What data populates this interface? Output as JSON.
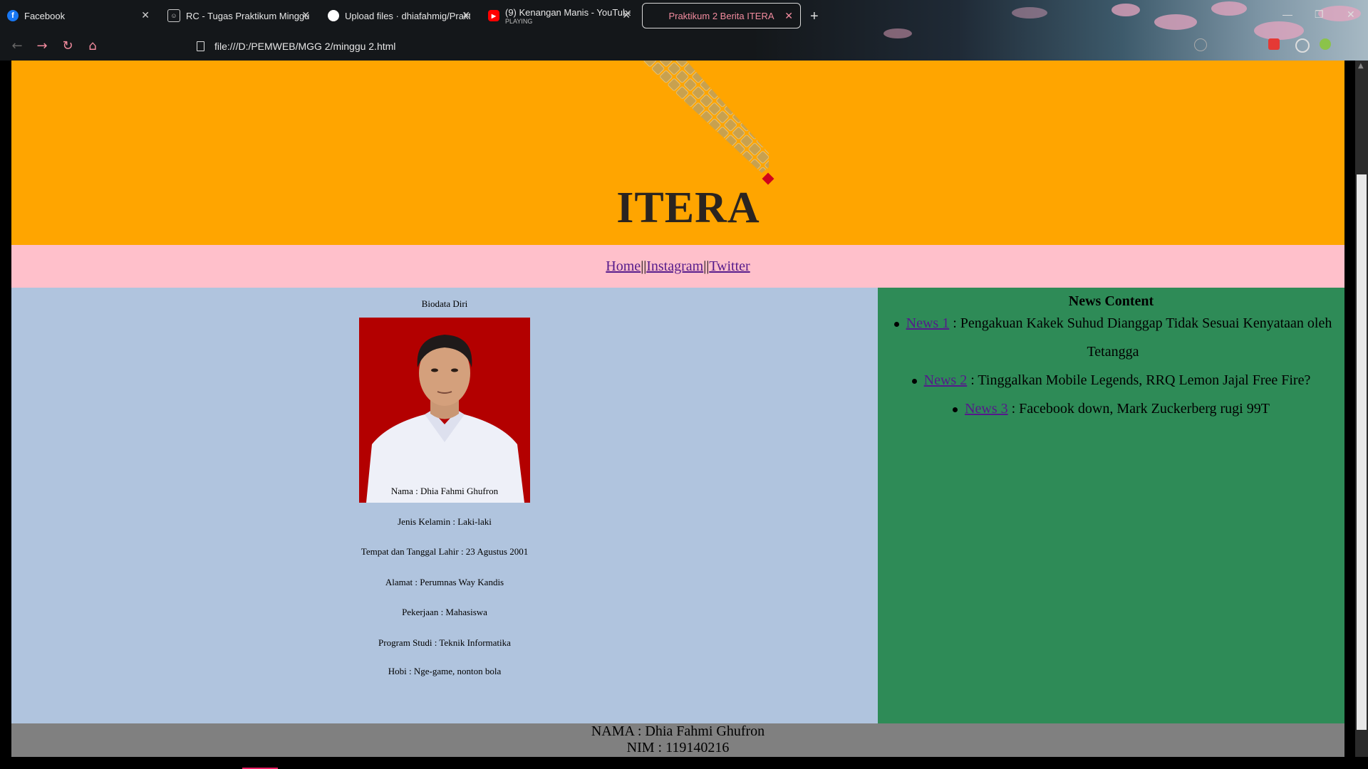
{
  "browser": {
    "tabs": [
      {
        "title": "Facebook",
        "icon": "facebook-icon",
        "color": "#1877f2"
      },
      {
        "title": "RC - Tugas Praktikum Minggu 2",
        "icon": "classroom-icon",
        "color": "#bbbbbb"
      },
      {
        "title": "Upload files · dhiafahmig/Prakt",
        "icon": "github-icon",
        "color": "#ffffff"
      },
      {
        "title": "(9) Kenangan Manis - YouTube",
        "subtitle": "PLAYING",
        "icon": "youtube-icon",
        "color": "#ff0000"
      },
      {
        "title": "Praktikum 2 Berita ITERA",
        "icon": "page-icon",
        "color": "#f28b9e",
        "active": true
      }
    ],
    "url": "file:///D:/PEMWEB/MGG 2/minggu 2.html"
  },
  "header": {
    "logo_text": "ITERA",
    "colors": {
      "background": "#ffa500",
      "diamond": "#c8a14f",
      "accent": "#d0021b"
    }
  },
  "menu": {
    "links": [
      "Home",
      "Instagram",
      "Twitter"
    ],
    "separator": "||",
    "background": "#ffc0cb"
  },
  "bio": {
    "title": "Biodata Diri",
    "lines": [
      "Nama : Dhia Fahmi Ghufron",
      "Jenis Kelamin : Laki-laki",
      "Tempat dan Tanggal Lahir : 23 Agustus 2001",
      "Alamat : Perumnas Way Kandis",
      "Pekerjaan : Mahasiswa",
      "Program Studi : Teknik Informatika",
      "Hobi : Nge-game, nonton bola"
    ],
    "background": "#b0c4de"
  },
  "news": {
    "heading": "News Content",
    "items": [
      {
        "link": "News 1",
        "text": " : Pengakuan Kakek Suhud Dianggap Tidak Sesuai Kenyataan oleh",
        "text2": "Tetangga"
      },
      {
        "link": "News 2",
        "text": " : Tinggalkan Mobile Legends, RRQ Lemon Jajal Free Fire?"
      },
      {
        "link": "News 3",
        "text": " : Facebook down, Mark Zuckerberg rugi 99T"
      }
    ],
    "background": "#2e8b57"
  },
  "footer": {
    "name": "NAMA : Dhia Fahmi Ghufron",
    "nim": "NIM : 119140216",
    "background": "#808080"
  }
}
